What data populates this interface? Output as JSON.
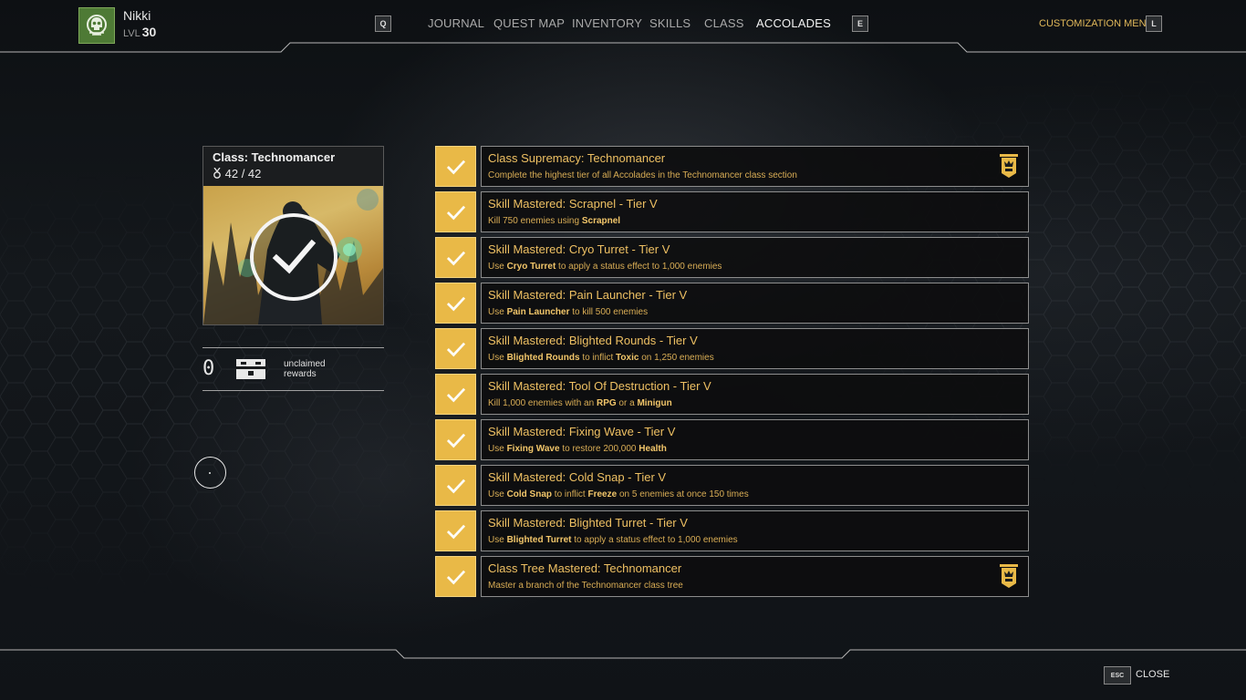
{
  "player": {
    "name": "Nikki",
    "level_prefix": "LVL",
    "level": "30",
    "badge_icon": "skull-icon"
  },
  "nav": {
    "prev_key": "Q",
    "next_key": "E",
    "tabs": [
      "JOURNAL",
      "QUEST MAP",
      "INVENTORY",
      "SKILLS",
      "CLASS",
      "ACCOLADES"
    ],
    "active_tab": "ACCOLADES"
  },
  "customization": {
    "label": "CUSTOMIZATION MENU",
    "key": "L"
  },
  "class_card": {
    "title": "Class: Technomancer",
    "progress": "42 / 42",
    "progress_icon": "accolade-medal-icon",
    "completed": true
  },
  "rewards": {
    "count": "0",
    "label": "unclaimed rewards",
    "icon": "reward-chest-icon"
  },
  "accolades": [
    {
      "title": "Class Supremacy: Technomancer",
      "desc": [
        {
          "t": "Complete the highest tier of all Accolades in the Technomancer class section"
        }
      ],
      "completed": true,
      "emblem": true
    },
    {
      "title": "Skill Mastered: Scrapnel - Tier V",
      "desc": [
        {
          "t": "Kill 750 enemies using "
        },
        {
          "t": "Scrapnel",
          "b": true
        }
      ],
      "completed": true,
      "emblem": false
    },
    {
      "title": "Skill Mastered: Cryo Turret - Tier V",
      "desc": [
        {
          "t": "Use "
        },
        {
          "t": "Cryo Turret",
          "b": true
        },
        {
          "t": " to apply a status effect to 1,000 enemies"
        }
      ],
      "completed": true,
      "emblem": false
    },
    {
      "title": "Skill Mastered: Pain Launcher - Tier V",
      "desc": [
        {
          "t": "Use "
        },
        {
          "t": "Pain Launcher",
          "b": true
        },
        {
          "t": " to kill 500 enemies"
        }
      ],
      "completed": true,
      "emblem": false
    },
    {
      "title": "Skill Mastered: Blighted Rounds - Tier V",
      "desc": [
        {
          "t": "Use "
        },
        {
          "t": "Blighted Rounds",
          "b": true
        },
        {
          "t": " to inflict "
        },
        {
          "t": "Toxic",
          "b": true
        },
        {
          "t": " on 1,250 enemies"
        }
      ],
      "completed": true,
      "emblem": false
    },
    {
      "title": "Skill Mastered: Tool Of Destruction - Tier V",
      "desc": [
        {
          "t": "Kill 1,000 enemies with an "
        },
        {
          "t": "RPG",
          "b": true
        },
        {
          "t": " or a "
        },
        {
          "t": "Minigun",
          "b": true
        }
      ],
      "completed": true,
      "emblem": false
    },
    {
      "title": "Skill Mastered: Fixing Wave - Tier V",
      "desc": [
        {
          "t": "Use "
        },
        {
          "t": "Fixing Wave",
          "b": true
        },
        {
          "t": " to restore 200,000 "
        },
        {
          "t": "Health",
          "b": true
        }
      ],
      "completed": true,
      "emblem": false
    },
    {
      "title": "Skill Mastered: Cold Snap - Tier V",
      "desc": [
        {
          "t": "Use "
        },
        {
          "t": "Cold Snap",
          "b": true
        },
        {
          "t": " to inflict "
        },
        {
          "t": "Freeze",
          "b": true
        },
        {
          "t": " on 5 enemies at once 150 times"
        }
      ],
      "completed": true,
      "emblem": false
    },
    {
      "title": "Skill Mastered: Blighted Turret - Tier V",
      "desc": [
        {
          "t": "Use "
        },
        {
          "t": "Blighted Turret",
          "b": true
        },
        {
          "t": " to apply a status effect to 1,000 enemies"
        }
      ],
      "completed": true,
      "emblem": false
    },
    {
      "title": "Class Tree Mastered: Technomancer",
      "desc": [
        {
          "t": "Master a branch of the Technomancer class tree"
        }
      ],
      "completed": true,
      "emblem": true
    }
  ],
  "footer": {
    "close_key": "ESC",
    "close_label": "CLOSE"
  },
  "colors": {
    "accent_gold": "#e9b947",
    "title_gold": "#eec063",
    "badge_green": "#4e7a35"
  }
}
